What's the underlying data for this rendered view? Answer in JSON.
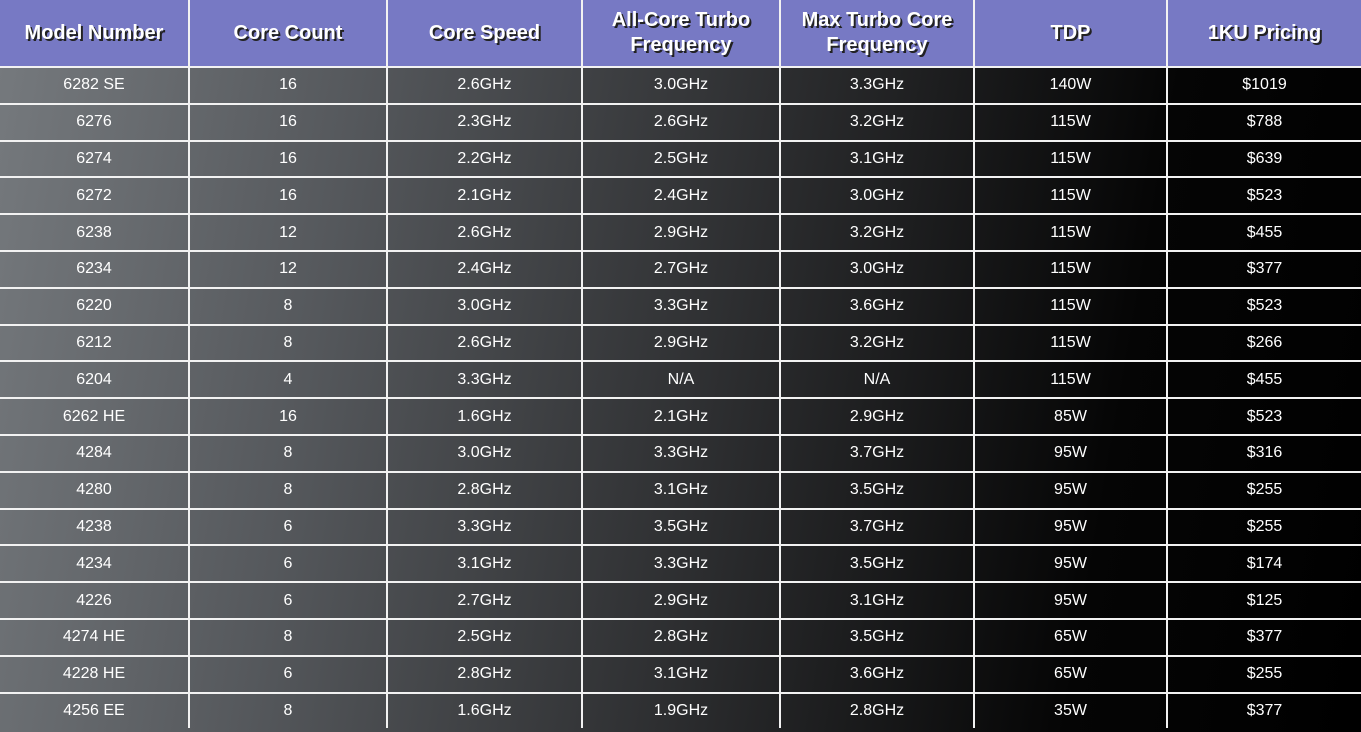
{
  "table": {
    "headers": [
      "Model Number",
      "Core Count",
      "Core Speed",
      "All-Core Turbo Frequency",
      "Max Turbo Core Frequency",
      "TDP",
      "1KU Pricing"
    ],
    "rows": [
      [
        "6282 SE",
        "16",
        "2.6GHz",
        "3.0GHz",
        "3.3GHz",
        "140W",
        "$1019"
      ],
      [
        "6276",
        "16",
        "2.3GHz",
        "2.6GHz",
        "3.2GHz",
        "115W",
        "$788"
      ],
      [
        "6274",
        "16",
        "2.2GHz",
        "2.5GHz",
        "3.1GHz",
        "115W",
        "$639"
      ],
      [
        "6272",
        "16",
        "2.1GHz",
        "2.4GHz",
        "3.0GHz",
        "115W",
        "$523"
      ],
      [
        "6238",
        "12",
        "2.6GHz",
        "2.9GHz",
        "3.2GHz",
        "115W",
        "$455"
      ],
      [
        "6234",
        "12",
        "2.4GHz",
        "2.7GHz",
        "3.0GHz",
        "115W",
        "$377"
      ],
      [
        "6220",
        "8",
        "3.0GHz",
        "3.3GHz",
        "3.6GHz",
        "115W",
        "$523"
      ],
      [
        "6212",
        "8",
        "2.6GHz",
        "2.9GHz",
        "3.2GHz",
        "115W",
        "$266"
      ],
      [
        "6204",
        "4",
        "3.3GHz",
        "N/A",
        "N/A",
        "115W",
        "$455"
      ],
      [
        "6262 HE",
        "16",
        "1.6GHz",
        "2.1GHz",
        "2.9GHz",
        "85W",
        "$523"
      ],
      [
        "4284",
        "8",
        "3.0GHz",
        "3.3GHz",
        "3.7GHz",
        "95W",
        "$316"
      ],
      [
        "4280",
        "8",
        "2.8GHz",
        "3.1GHz",
        "3.5GHz",
        "95W",
        "$255"
      ],
      [
        "4238",
        "6",
        "3.3GHz",
        "3.5GHz",
        "3.7GHz",
        "95W",
        "$255"
      ],
      [
        "4234",
        "6",
        "3.1GHz",
        "3.3GHz",
        "3.5GHz",
        "95W",
        "$174"
      ],
      [
        "4226",
        "6",
        "2.7GHz",
        "2.9GHz",
        "3.1GHz",
        "95W",
        "$125"
      ],
      [
        "4274 HE",
        "8",
        "2.5GHz",
        "2.8GHz",
        "3.5GHz",
        "65W",
        "$377"
      ],
      [
        "4228 HE",
        "6",
        "2.8GHz",
        "3.1GHz",
        "3.6GHz",
        "65W",
        "$255"
      ],
      [
        "4256 EE",
        "8",
        "1.6GHz",
        "1.9GHz",
        "2.8GHz",
        "35W",
        "$377"
      ]
    ]
  },
  "colors": {
    "header_bg": "#7779c4",
    "text": "#ffffff",
    "grid": "#f2f2f2"
  }
}
